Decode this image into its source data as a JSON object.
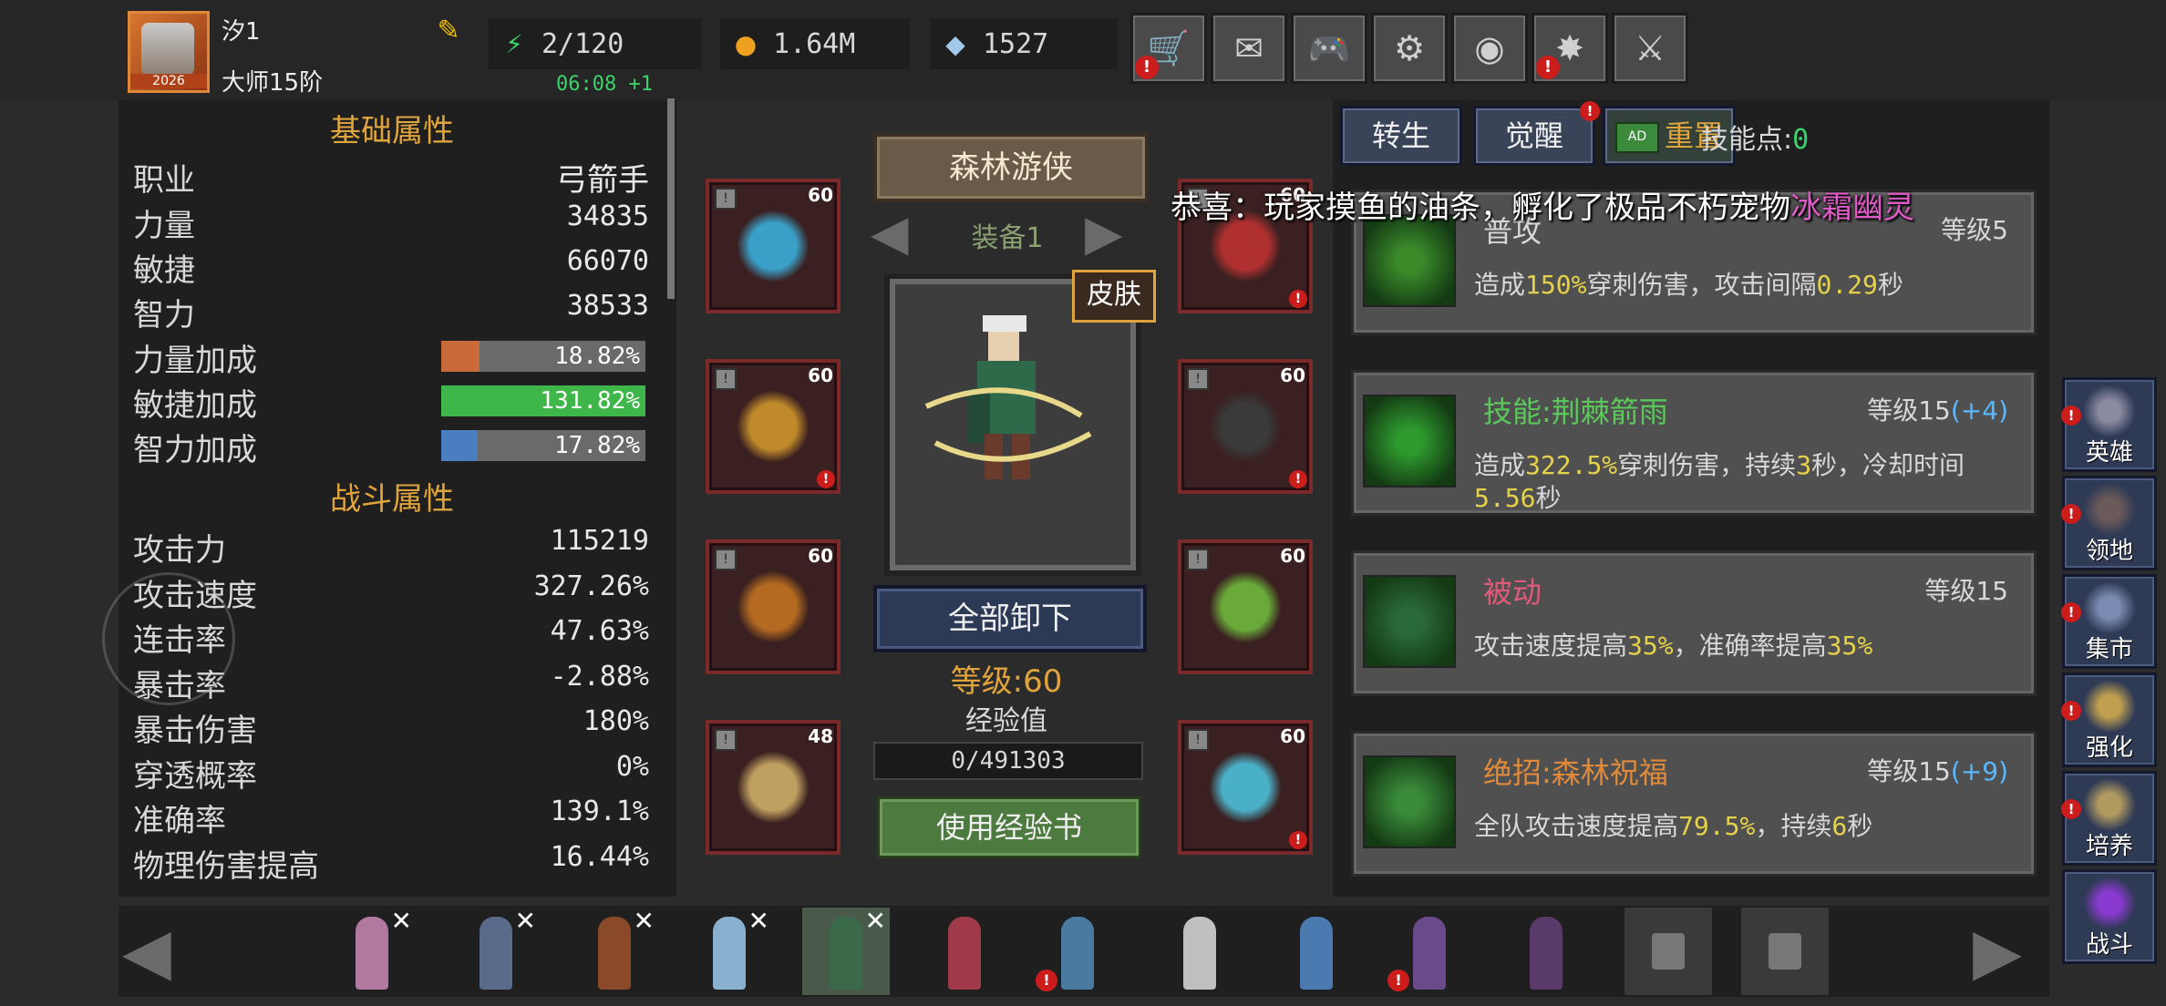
{
  "player": {
    "name": "汐1",
    "rank": "大师15阶",
    "avatar_year": "2026",
    "timer": "06:08 +1"
  },
  "resources": {
    "energy": "2/120",
    "gold": "1.64M",
    "gems": "1527"
  },
  "top_buttons": [
    {
      "name": "shop",
      "icon": "🛒",
      "alert": true
    },
    {
      "name": "mail",
      "icon": "✉",
      "alert": false
    },
    {
      "name": "gamepad",
      "icon": "🎮",
      "alert": false
    },
    {
      "name": "settings",
      "icon": "⚙",
      "alert": false
    },
    {
      "name": "color-wheel",
      "icon": "◉",
      "alert": false
    },
    {
      "name": "fireworks",
      "icon": "✸",
      "alert": true
    },
    {
      "name": "battle-off",
      "icon": "⚔",
      "alert": false
    }
  ],
  "stats": {
    "basic_title": "基础属性",
    "combat_title": "战斗属性",
    "class_label": "职业",
    "class_value": "弓箭手",
    "basic": [
      {
        "label": "力量",
        "value": "34835"
      },
      {
        "label": "敏捷",
        "value": "66070"
      },
      {
        "label": "智力",
        "value": "38533"
      }
    ],
    "bonuses": [
      {
        "label": "力量加成",
        "value": "18.82%",
        "pct": 18.82,
        "color": "#c96a3a"
      },
      {
        "label": "敏捷加成",
        "value": "131.82%",
        "pct": 100,
        "color": "#3fb64a"
      },
      {
        "label": "智力加成",
        "value": "17.82%",
        "pct": 17.82,
        "color": "#4a7ec0"
      }
    ],
    "combat": [
      {
        "label": "攻击力",
        "value": "115219"
      },
      {
        "label": "攻击速度",
        "value": "327.26%"
      },
      {
        "label": "连击率",
        "value": "47.63%"
      },
      {
        "label": "暴击率",
        "value": "-2.88%"
      },
      {
        "label": "暴击伤害",
        "value": "180%"
      },
      {
        "label": "穿透概率",
        "value": "0%"
      },
      {
        "label": "准确率",
        "value": "139.1%"
      },
      {
        "label": "物理伤害提高",
        "value": "16.44%"
      }
    ]
  },
  "equipment": {
    "hero_class": "森林游侠",
    "gear_set": "装备1",
    "skin_label": "皮肤",
    "unequip_all": "全部卸下",
    "level_text": "等级:60",
    "exp_label": "经验值",
    "exp_value": "0/491303",
    "exp_progress": 0,
    "use_exp_book": "使用经验书",
    "left_slots": [
      {
        "name": "crown",
        "level": "60",
        "color": "#3aa0c8",
        "alert": false
      },
      {
        "name": "armor",
        "level": "60",
        "color": "#c08a2a",
        "alert": true
      },
      {
        "name": "greaves",
        "level": "60",
        "color": "#b46a20",
        "alert": false
      },
      {
        "name": "boots",
        "level": "48",
        "color": "#c0a060",
        "alert": false
      }
    ],
    "right_slots": [
      {
        "name": "amulet",
        "level": "60",
        "color": "#b03030",
        "alert": true
      },
      {
        "name": "gauntlet",
        "level": "60",
        "color": "#3a3a3a",
        "alert": true
      },
      {
        "name": "ring",
        "level": "60",
        "color": "#6aaa3a",
        "alert": false
      },
      {
        "name": "crossbow",
        "level": "60",
        "color": "#4ab0c8",
        "alert": true
      }
    ]
  },
  "skills_tabs": {
    "rebirth": "转生",
    "awaken": "觉醒",
    "reset": "重置",
    "skill_points_label": "技能点:",
    "skill_points": "0"
  },
  "broadcast": {
    "prefix": "恭喜：玩家摸鱼的油条，孵化了极品不朽宠物",
    "pet": "冰霜幽灵"
  },
  "skills": [
    {
      "name": "普攻",
      "name_color": "#d8d8d8",
      "level": "等级5",
      "bonus": "",
      "desc": [
        [
          "造成",
          ""
        ],
        [
          "150%",
          "hl"
        ],
        [
          "穿刺伤害，攻击间隔",
          ""
        ],
        [
          "0.29",
          "hl"
        ],
        [
          "秒",
          ""
        ]
      ],
      "icon_color": "#3a8a2a"
    },
    {
      "name": "技能:荆棘箭雨",
      "name_color": "#5ac85a",
      "level": "等级15",
      "bonus": "(+4)",
      "desc": [
        [
          "造成",
          ""
        ],
        [
          "322.5%",
          "hl"
        ],
        [
          "穿刺伤害，持续",
          ""
        ],
        [
          "3",
          "hl"
        ],
        [
          "秒，冷却时间",
          ""
        ],
        [
          "5.56",
          "hl"
        ],
        [
          "秒",
          ""
        ]
      ],
      "icon_color": "#2e9a2e"
    },
    {
      "name": "被动",
      "name_color": "#e05a7a",
      "level": "等级15",
      "bonus": "",
      "desc": [
        [
          "攻击速度提高",
          ""
        ],
        [
          "35%",
          "hl"
        ],
        [
          "，准确率提高",
          ""
        ],
        [
          "35%",
          "hl"
        ]
      ],
      "icon_color": "#2a6a3a"
    },
    {
      "name": "绝招:森林祝福",
      "name_color": "#e08a3a",
      "level": "等级15",
      "bonus": "(+9)",
      "desc": [
        [
          "全队攻击速度提高",
          ""
        ],
        [
          "79.5%",
          "hl"
        ],
        [
          "，持续",
          ""
        ],
        [
          "6",
          "hl"
        ],
        [
          "秒",
          ""
        ]
      ],
      "icon_color": "#3a8a3a"
    }
  ],
  "side_menu": [
    {
      "name": "hero",
      "label": "英雄",
      "color": "#8a8aa0",
      "alert": true
    },
    {
      "name": "territory",
      "label": "领地",
      "color": "#6a5a5a",
      "alert": true
    },
    {
      "name": "market",
      "label": "集市",
      "color": "#7a8ab0",
      "alert": true
    },
    {
      "name": "enhance",
      "label": "强化",
      "color": "#c0a050",
      "alert": true
    },
    {
      "name": "cultivate",
      "label": "培养",
      "color": "#b09a60",
      "alert": true
    },
    {
      "name": "battle",
      "label": "战斗",
      "color": "#8a3ad0",
      "alert": false
    }
  ],
  "hero_strip": [
    {
      "color": "#b07aa0",
      "x": true,
      "alert": false,
      "state": ""
    },
    {
      "color": "#5a6a8a",
      "x": true,
      "alert": false,
      "state": ""
    },
    {
      "color": "#8a4a2a",
      "x": true,
      "alert": false,
      "state": ""
    },
    {
      "color": "#8ab0d0",
      "x": true,
      "alert": false,
      "state": ""
    },
    {
      "color": "#3a6a4a",
      "x": true,
      "alert": false,
      "state": "selected"
    },
    {
      "color": "#a03a4a",
      "x": false,
      "alert": false,
      "state": ""
    },
    {
      "color": "#4a7aa0",
      "x": false,
      "alert": true,
      "state": ""
    },
    {
      "color": "#c0c0c0",
      "x": false,
      "alert": false,
      "state": ""
    },
    {
      "color": "#4a7ab0",
      "x": false,
      "alert": false,
      "state": ""
    },
    {
      "color": "#6a4a8a",
      "x": false,
      "alert": true,
      "state": ""
    },
    {
      "color": "#5a3a6a",
      "x": false,
      "alert": false,
      "state": ""
    },
    {
      "color": "",
      "x": false,
      "alert": false,
      "state": "locked"
    },
    {
      "color": "",
      "x": false,
      "alert": false,
      "state": "locked"
    }
  ]
}
